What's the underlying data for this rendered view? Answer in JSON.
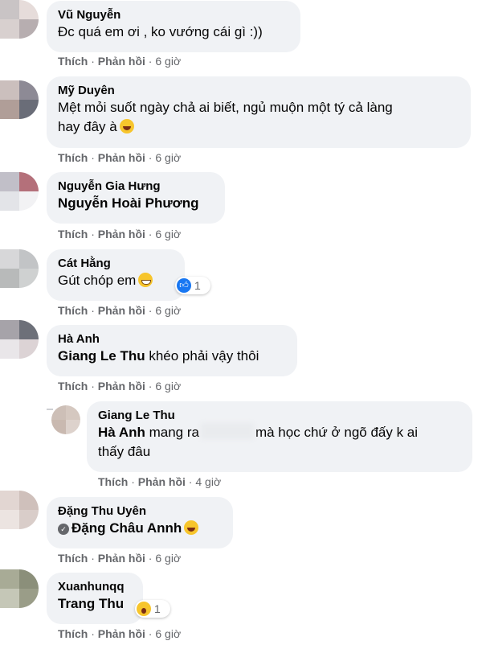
{
  "action_labels": {
    "like": "Thích",
    "reply": "Phản hồi",
    "sep": " · "
  },
  "comments": [
    {
      "name": "Vũ Nguyễn",
      "text": "Đc quá em ơi , ko vướng cái gì :))",
      "time": "6 giờ"
    },
    {
      "name": "Mỹ Duyên",
      "text_line1": "Mệt mỏi suốt ngày chả ai biết, ngủ muộn một tý cả làng",
      "text_line2": "hay đây à",
      "emoji": "laughing-emoji",
      "time": "6 giờ"
    },
    {
      "name": "Nguyễn Gia Hưng",
      "tag": "Nguyễn Hoài Phương",
      "time": "6 giờ"
    },
    {
      "name": "Cát Hằng",
      "text": "Gút chóp em",
      "emoji": "grinning-emoji",
      "reaction": "like",
      "reaction_count": "1",
      "time": "6 giờ"
    },
    {
      "name": "Hà Anh",
      "tag": "Giang Le Thu",
      "text": " khéo phải vậy thôi",
      "time": "6 giờ"
    },
    {
      "name": "Giang Le Thu",
      "tag": "Hà Anh",
      "text_before": " mang ra",
      "text_after": "mà học chứ ở ngõ đấy k ai",
      "text_line2": "thấy đâu",
      "time": "4 giờ",
      "is_reply": true
    },
    {
      "name": "Đặng Thu Uyên",
      "tag": "Đặng Châu Annh",
      "emoji": "laughing-emoji",
      "time": "6 giờ"
    },
    {
      "name": "Xuanhunqq",
      "tag": "Trang Thu",
      "emoji": "surprised-emoji",
      "reaction": "wow",
      "reaction_count": "1",
      "time": "6 giờ"
    }
  ],
  "colors": {
    "bubble": "#f0f2f5",
    "meta": "#65676b",
    "like_blue": "#1877f2"
  }
}
